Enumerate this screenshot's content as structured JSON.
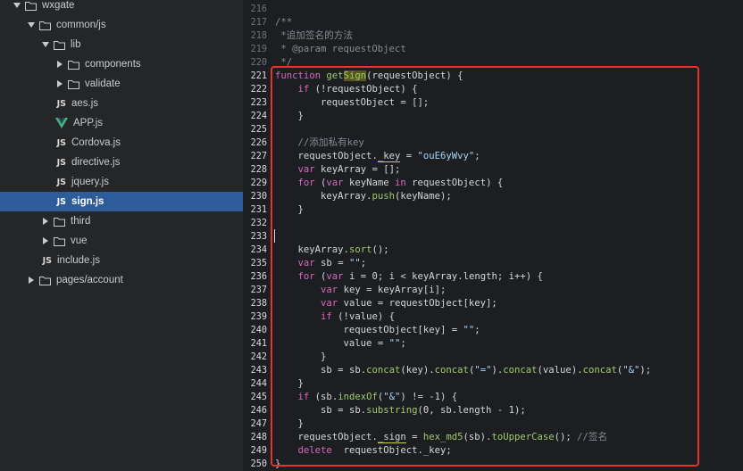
{
  "sidebar": {
    "items": [
      {
        "label": "wxgate",
        "type": "folder",
        "expanded": true
      },
      {
        "label": "common/js",
        "type": "folder",
        "expanded": true
      },
      {
        "label": "lib",
        "type": "folder",
        "expanded": true
      },
      {
        "label": "components",
        "type": "folder",
        "expanded": false
      },
      {
        "label": "validate",
        "type": "folder",
        "expanded": false
      },
      {
        "label": "aes.js",
        "type": "js",
        "badge": "JS"
      },
      {
        "label": "APP.js",
        "type": "vue",
        "icon": "vue-logo-icon"
      },
      {
        "label": "Cordova.js",
        "type": "js",
        "badge": "JS"
      },
      {
        "label": "directive.js",
        "type": "js",
        "badge": "JS"
      },
      {
        "label": "jquery.js",
        "type": "js",
        "badge": "JS"
      },
      {
        "label": "sign.js",
        "type": "js",
        "badge": "JS",
        "selected": true
      },
      {
        "label": "third",
        "type": "folder",
        "expanded": false
      },
      {
        "label": "vue",
        "type": "folder",
        "expanded": false
      },
      {
        "label": "include.js",
        "type": "js",
        "badge": "JS"
      },
      {
        "label": "pages/account",
        "type": "folder",
        "expanded": false
      }
    ]
  },
  "editor": {
    "line_numbers": [
      "216",
      "217",
      "218",
      "219",
      "220",
      "221",
      "222",
      "223",
      "224",
      "225",
      "226",
      "227",
      "228",
      "229",
      "230",
      "231",
      "232",
      "233",
      "234",
      "235",
      "236",
      "237",
      "238",
      "239",
      "240",
      "241",
      "242",
      "243",
      "244",
      "245",
      "246",
      "247",
      "248",
      "249",
      "250"
    ],
    "lines": [
      "",
      "/**",
      " *追加签名的方法",
      " * @param requestObject",
      " */",
      "function getSign(requestObject) {",
      "    if (!requestObject) {",
      "        requestObject = [];",
      "    }",
      "",
      "    //添加私有key",
      "    requestObject._key = \"ouE6yWvy\";",
      "    var keyArray = [];",
      "    for (var keyName in requestObject) {",
      "        keyArray.push(keyName);",
      "    }",
      "",
      "",
      "    keyArray.sort();",
      "    var sb = \"\";",
      "    for (var i = 0; i < keyArray.length; i++) {",
      "        var key = keyArray[i];",
      "        var value = requestObject[key];",
      "        if (!value) {",
      "            requestObject[key] = \"\";",
      "            value = \"\";",
      "        }",
      "        sb = sb.concat(key).concat(\"=\").concat(value).concat(\"&\");",
      "    }",
      "    if (sb.indexOf(\"&\") != -1) {",
      "        sb = sb.substring(0, sb.length - 1);",
      "    }",
      "    requestObject._sign = hex_md5(sb).toUpperCase(); //签名",
      "    delete  requestObject._key;",
      "}"
    ],
    "highlighted_from_line": "221",
    "annotation_color": "#e8322a"
  }
}
